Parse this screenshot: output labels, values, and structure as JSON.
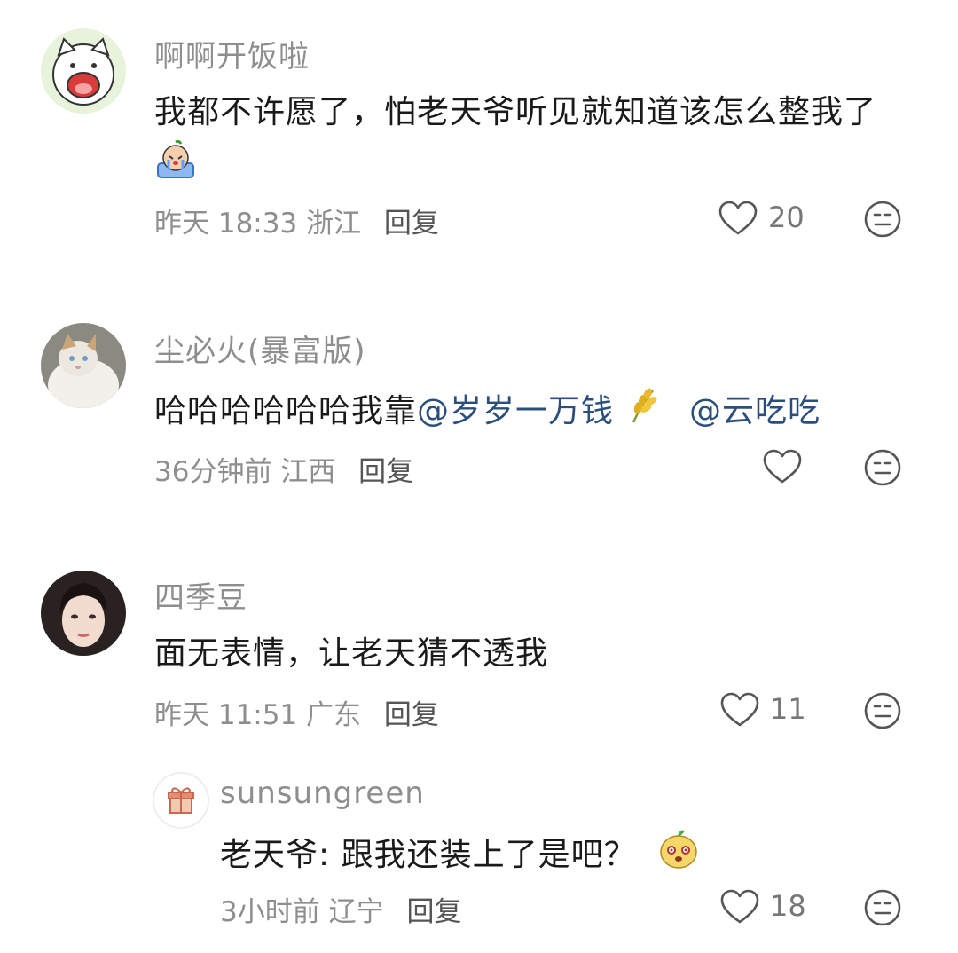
{
  "comments": [
    {
      "username": "啊啊开饭啦",
      "text": "我都不许愿了，怕老天爷听见就知道该怎么整我了",
      "time": "昨天 18:33",
      "location": "浙江",
      "reply": "回复",
      "likes": "20"
    },
    {
      "username": "尘必火(暴富版)",
      "text_prefix": "哈哈哈哈哈哈我靠",
      "mention1": "@岁岁一万钱",
      "mention2": "@云吃吃",
      "time": "36分钟前",
      "location": "江西",
      "reply": "回复",
      "likes": ""
    },
    {
      "username": "四季豆",
      "text": "面无表情，让老天猜不透我",
      "time": "昨天 11:51",
      "location": "广东",
      "reply": "回复",
      "likes": "11"
    }
  ],
  "reply": {
    "username": "sunsungreen",
    "text": "老天爷: 跟我还装上了是吧？",
    "time": "3小时前",
    "location": "辽宁",
    "reply": "回复",
    "likes": "18"
  },
  "icons": {
    "like": "heart-outline-icon",
    "emoji": "neutral-face-icon",
    "gift": "gift-icon"
  },
  "colors": {
    "mention": "#2b4f7c",
    "muted": "#8e8e8e"
  }
}
